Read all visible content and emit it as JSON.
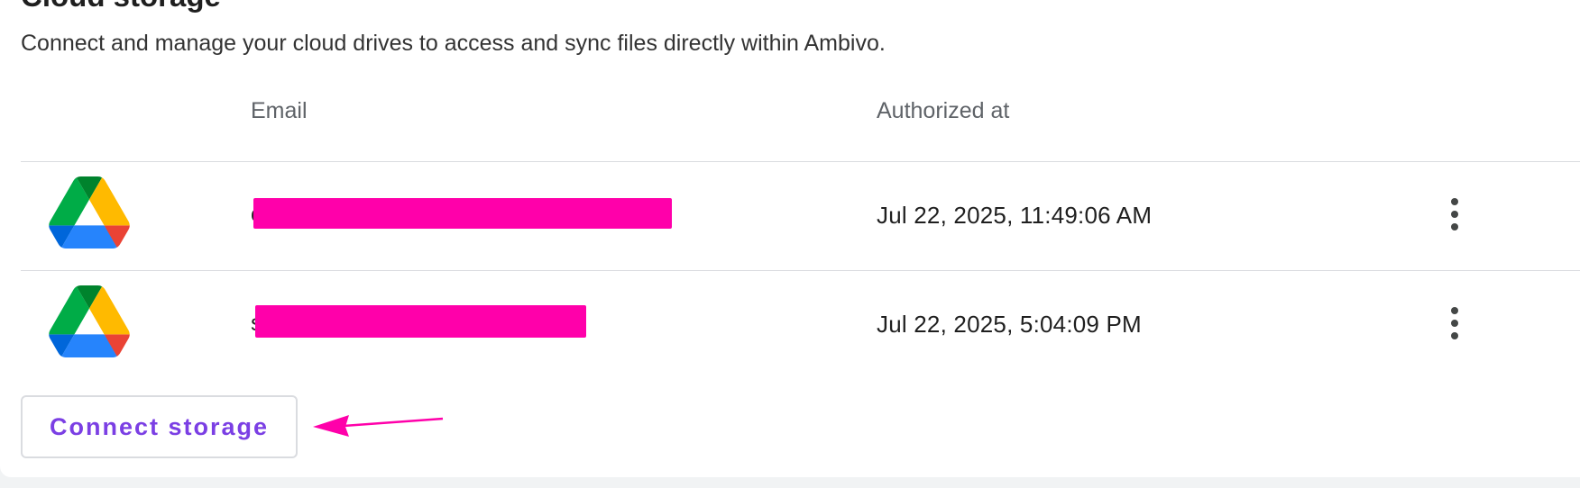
{
  "section": {
    "title": "Cloud storage",
    "description": "Connect and manage your cloud drives to access and sync files directly within Ambivo."
  },
  "table": {
    "columns": [
      "",
      "Email",
      "Authorized at",
      ""
    ],
    "rows": [
      {
        "icon": "google-drive-icon",
        "email_visible": "c",
        "email_redacted": true,
        "authorized_at": "Jul 22, 2025, 11:49:06 AM"
      },
      {
        "icon": "google-drive-icon",
        "email_visible": "s",
        "email_redacted": true,
        "authorized_at": "Jul 22, 2025, 5:04:09 PM"
      }
    ]
  },
  "actions": {
    "connect_label": "Connect storage"
  },
  "colors": {
    "accent": "#7b3fe4",
    "redaction": "#ff00aa",
    "divider": "#dadce0"
  }
}
